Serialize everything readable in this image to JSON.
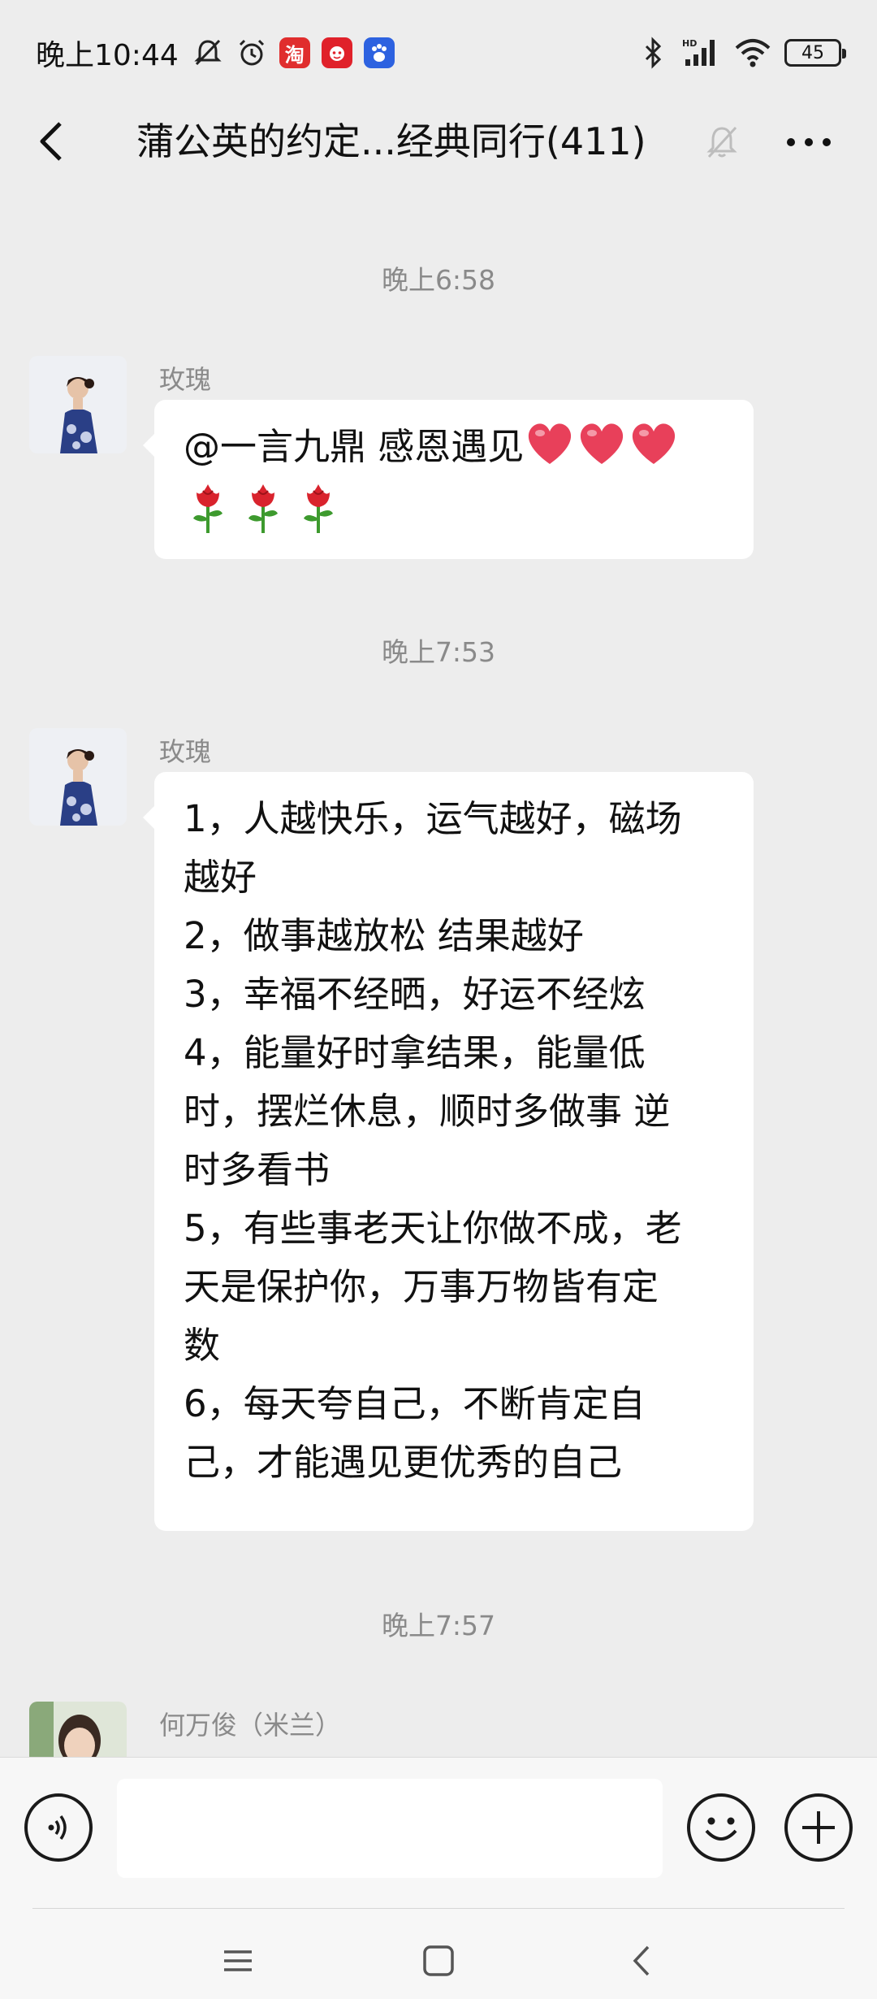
{
  "status_bar": {
    "time": "晚上10:44",
    "left_icons": [
      "mute-bell-icon",
      "alarm-icon",
      "taobao-app-icon",
      "pinduoduo-app-icon",
      "baidu-app-icon"
    ],
    "taobao_glyph": "淘",
    "right_icons": [
      "bluetooth-icon",
      "signal-hd-icon",
      "wifi-icon",
      "battery-icon"
    ],
    "signal_label": "HD",
    "battery": "45"
  },
  "nav": {
    "title": "蒲公英的约定...经典同行(411)",
    "icons": [
      "back-icon",
      "muted-bell-icon",
      "more-icon"
    ]
  },
  "messages": [
    {
      "timestamp": "晚上6:58",
      "sender": "玫瑰",
      "text": "@一言九鼎  感恩遇见",
      "emojis": [
        "heart",
        "heart",
        "heart",
        "rose",
        "rose",
        "rose"
      ]
    },
    {
      "timestamp": "晚上7:53",
      "sender": "玫瑰",
      "lines": [
        "1，人越快乐，运气越好，磁场",
        "越好",
        "2，做事越放松 结果越好",
        "3，幸福不经晒，好运不经炫",
        "4，能量好时拿结果，能量低",
        "时，摆烂休息，顺时多做事 逆",
        "时多看书",
        "5，有些事老天让你做不成，老",
        "天是保护你，万事万物皆有定",
        "数",
        "6，每天夸自己，不断肯定自",
        "己，才能遇见更优秀的自己"
      ]
    },
    {
      "timestamp": "晚上7:57",
      "sender": "何万俊（米兰）"
    }
  ],
  "input_bar": {
    "placeholder": "",
    "icons": [
      "voice-icon",
      "emoji-face-icon",
      "plus-icon"
    ]
  },
  "system_nav": {
    "icons": [
      "menu-icon",
      "home-square-icon",
      "back-chevron-icon"
    ]
  },
  "colors": {
    "background": "#ededed",
    "bubble": "#ffffff",
    "timestamp": "#8a8a8a",
    "heart": "#e8405a",
    "rose": "#d9232d"
  }
}
